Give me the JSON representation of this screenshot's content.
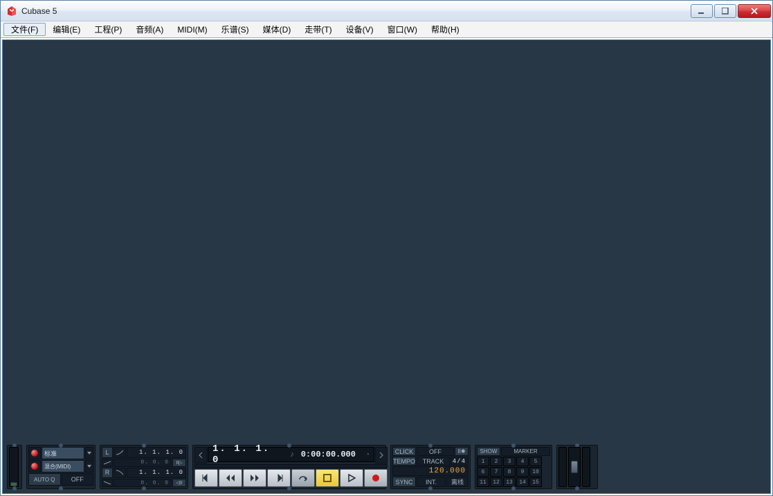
{
  "window": {
    "title": "Cubase 5"
  },
  "menu": {
    "items": [
      "文件(F)",
      "编辑(E)",
      "工程(P)",
      "音频(A)",
      "MIDI(M)",
      "乐谱(S)",
      "媒体(D)",
      "走带(T)",
      "设备(V)",
      "窗口(W)",
      "帮助(H)"
    ]
  },
  "transport": {
    "mode": {
      "normal": "标准",
      "mix": "混合(MIDI)",
      "autoq": "AUTO Q",
      "autoq_val": "OFF"
    },
    "locators": {
      "left_lbl": "L",
      "right_lbl": "R",
      "left_pos": "1.  1.  1.     0",
      "left_sub": "0.        0.    0",
      "right_pos": "1.  1.  1.     0",
      "right_sub": "0.        0.    0",
      "punch_in": "II▷",
      "punch_out": "◁II"
    },
    "position": {
      "main": "1.  1.  1.    0",
      "time": "0:00:00.000",
      "ruler_lbl": "♪"
    },
    "click": {
      "label": "CLICK",
      "value": "OFF",
      "precount": "II✱"
    },
    "tempo": {
      "label": "TEMPO",
      "mode": "TRACK",
      "sig": "4/4",
      "bpm": "120.000"
    },
    "sync": {
      "label": "SYNC",
      "mode": "INT.",
      "status": "离线"
    },
    "markers": {
      "show": "SHOW",
      "label": "MARKER",
      "cells": [
        "1",
        "2",
        "3",
        "4",
        "5",
        "6",
        "7",
        "8",
        "9",
        "10",
        "11",
        "12",
        "13",
        "14",
        "15"
      ]
    }
  }
}
